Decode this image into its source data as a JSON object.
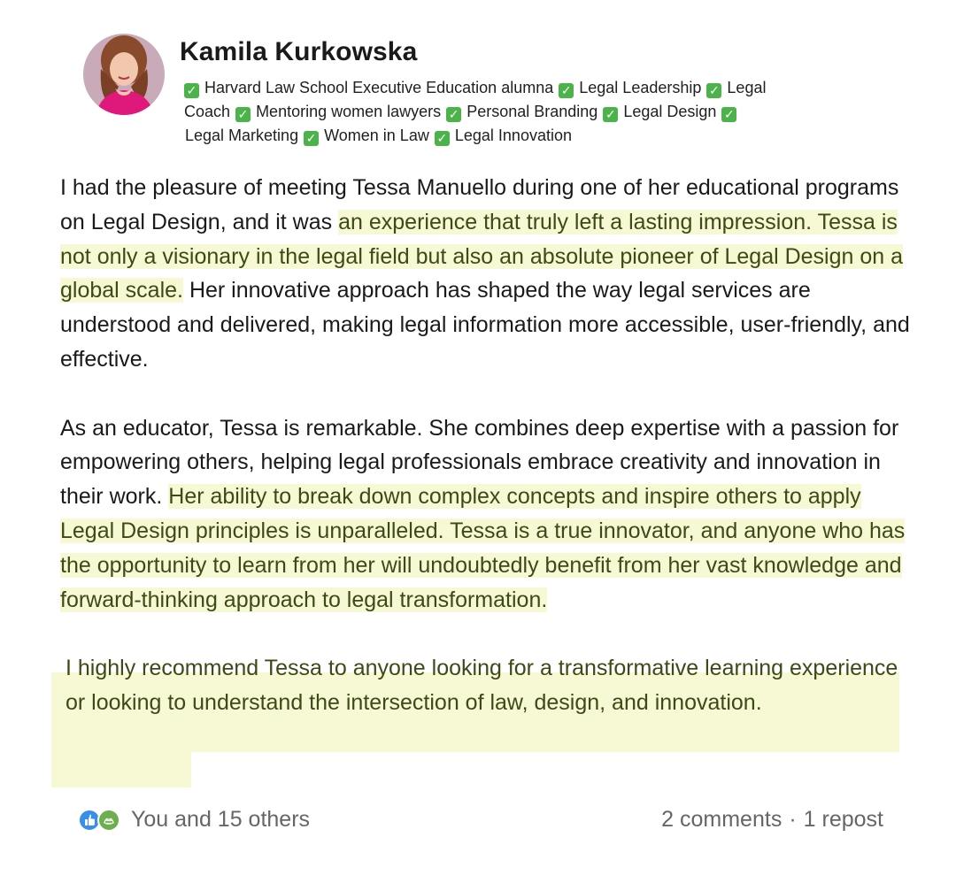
{
  "post": {
    "author": {
      "name": "Kamila Kurkowska",
      "headline_tags": [
        "Harvard Law School Executive Education alumna",
        "Legal Leadership",
        "Legal Coach",
        "Mentoring women lawyers",
        "Personal Branding",
        "Legal Design",
        "Legal Marketing",
        "Women in Law",
        "Legal Innovation"
      ]
    },
    "body": {
      "p1_a": "I had the pleasure of meeting Tessa Manuello during one of her educational programs on Legal Design, and it was",
      "p1_hl": "an experience that truly left a lasting impression. Tessa is not only a visionary in the legal field but also an absolute pioneer of Legal Design on a global scale.",
      "p1_b": "Her innovative approach has shaped the way legal services are understood and delivered, making legal information more accessible, user-friendly, and effective.",
      "p2_a": "As an educator, Tessa is remarkable. She combines deep expertise with a passion for empowering others, helping legal professionals embrace creativity and innovation in their work.",
      "p2_hl": "Her ability to break down complex concepts and inspire others to apply Legal Design principles is unparalleled. Tessa is a true innovator, and anyone who has the opportunity to learn from her will undoubtedly benefit from her vast knowledge and forward-thinking approach to legal transformation.",
      "p3": "I highly recommend Tessa to anyone looking for a transformative learning experience or looking to understand the intersection of law, design, and innovation."
    },
    "reactions": {
      "text": "You and 15 others"
    },
    "social": {
      "comments": "2 comments",
      "separator": "·",
      "reposts": "1 repost"
    }
  },
  "colors": {
    "highlight_bg": "#f6f9d3",
    "highlight_text": "#3d4a16",
    "check_green": "#4cb24a",
    "meta_text": "#666666"
  },
  "icons": [
    "avatar-photo",
    "check-mark-icon",
    "like-reaction-icon",
    "support-reaction-icon"
  ]
}
